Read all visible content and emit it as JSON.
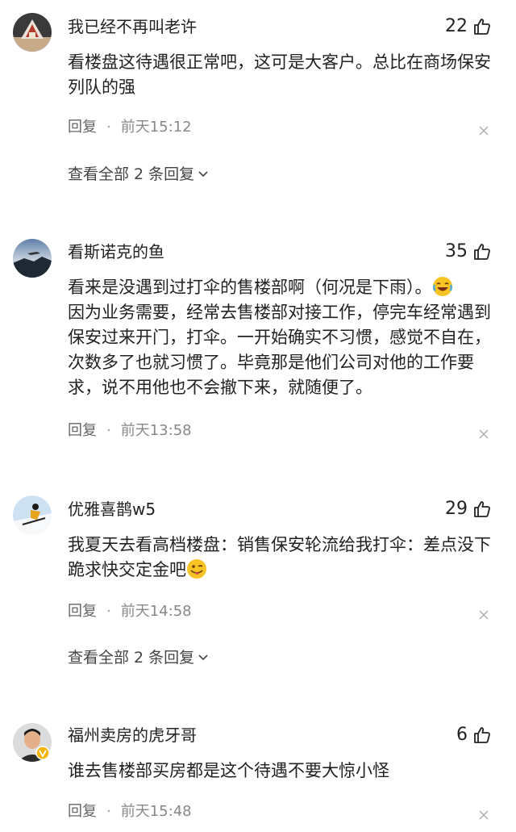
{
  "comments": [
    {
      "username": "我已经不再叫老许",
      "likes": "22",
      "content": "看楼盘这待遇很正常吧，这可是大客户。总比在商场保安列队的强",
      "reply_label": "回复",
      "time": "前天15:12",
      "view_replies": "查看全部 2 条回复",
      "avatar_icon": "building-avatar-icon"
    },
    {
      "username": "看斯诺克的鱼",
      "likes": "35",
      "content_line1": "看来是没遇到过打伞的售楼部啊（何况是下雨）。",
      "content_rest": "因为业务需要，经常去售楼部对接工作，停完车经常遇到保安过来开门，打伞。一开始确实不习惯，感觉不自在，次数多了也就习惯了。毕竟那是他们公司对他的工作要求，说不用他也不会撤下来，就随便了。",
      "reply_label": "回复",
      "time": "前天13:58",
      "avatar_icon": "landscape-avatar-icon",
      "emoji_icon": "laughing-crying-emoji-icon"
    },
    {
      "username": "优雅喜鹊w5",
      "likes": "29",
      "content": "我夏天去看高档楼盘：销售保安轮流给我打伞：差点没下跪求快交定金吧",
      "reply_label": "回复",
      "time": "前天14:58",
      "view_replies": "查看全部 2 条回复",
      "avatar_icon": "skier-avatar-icon",
      "emoji_icon": "winking-tongue-emoji-icon"
    },
    {
      "username": "福州卖房的虎牙哥",
      "likes": "6",
      "content": "谁去售楼部买房都是这个待遇不要大惊小怪",
      "reply_label": "回复",
      "time": "前天15:48",
      "avatar_icon": "person-avatar-icon",
      "badge_icon": "verified-badge-icon"
    }
  ],
  "colors": {
    "text": "#222222",
    "meta": "#888888",
    "badge": "#f5b400"
  }
}
